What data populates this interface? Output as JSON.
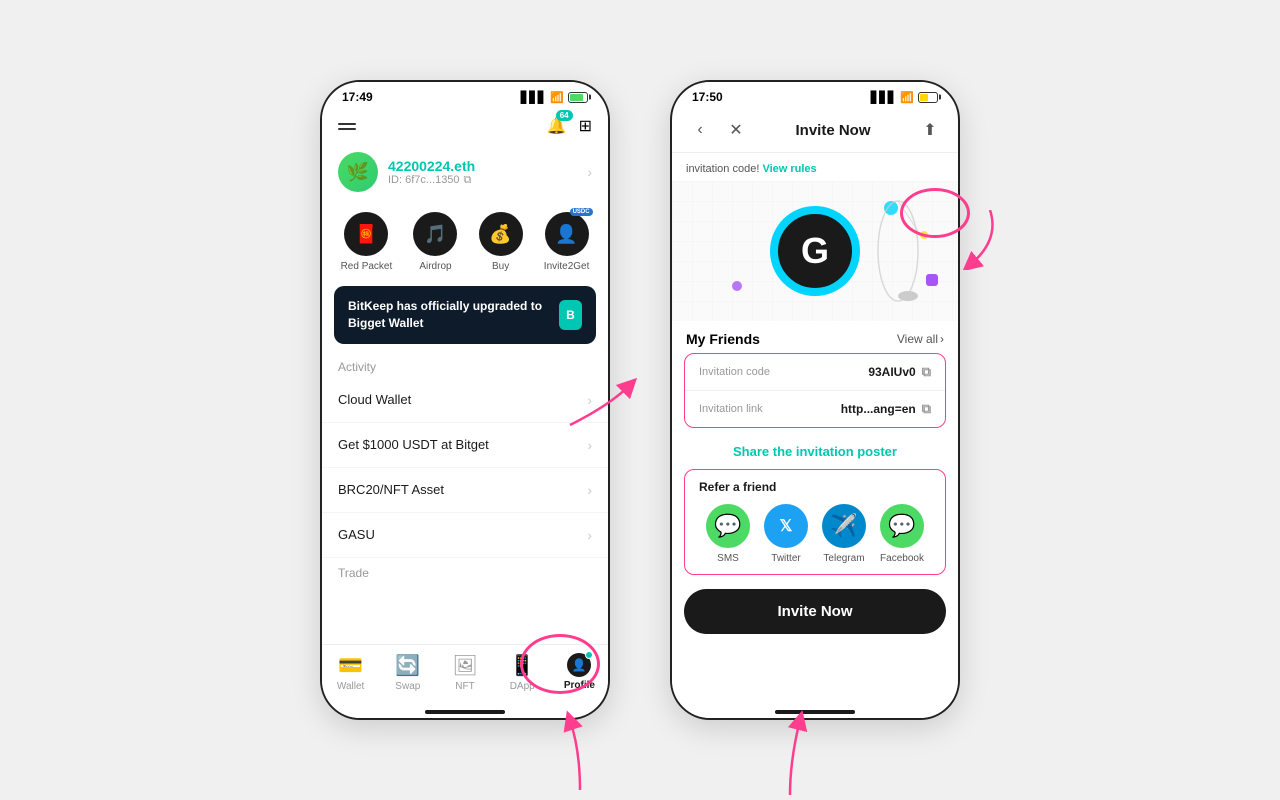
{
  "phone1": {
    "time": "17:49",
    "battery_fill": "green",
    "profile_name": "42200224.eth",
    "profile_id": "ID: 6f7c...1350",
    "actions": [
      {
        "label": "Red Packet",
        "icon": "🧧"
      },
      {
        "label": "Airdrop",
        "icon": "🎵"
      },
      {
        "label": "Buy",
        "icon": "💰"
      },
      {
        "label": "Invite2Get",
        "icon": "👤"
      }
    ],
    "banner_text": "BitKeep has officially upgraded to Bigget Wallet",
    "activity_label": "Activity",
    "activity_items": [
      {
        "text": "Cloud Wallet"
      },
      {
        "text": "Get $1000 USDT at Bitget"
      },
      {
        "text": "BRC20/NFT Asset"
      },
      {
        "text": "GASU"
      }
    ],
    "trade_label": "Trade",
    "bottom_nav": [
      {
        "label": "Wallet",
        "icon": "💳"
      },
      {
        "label": "Swap",
        "icon": "🔄"
      },
      {
        "label": "NFT",
        "icon": "🖼"
      },
      {
        "label": "DApp",
        "icon": "📱"
      },
      {
        "label": "Profile",
        "icon": "👤",
        "active": true
      }
    ],
    "bell_badge": "64"
  },
  "phone2": {
    "time": "17:50",
    "battery_fill": "yellow",
    "nav_title": "Invite Now",
    "promo_text": "invitation code!",
    "view_rules": "View rules",
    "friends_title": "My Friends",
    "view_all": "View all",
    "invitation_code_label": "Invitation code",
    "invitation_code_value": "93AIUv0",
    "invitation_link_label": "Invitation link",
    "invitation_link_value": "http...ang=en",
    "share_poster": "Share the invitation poster",
    "refer_title": "Refer a friend",
    "refer_items": [
      {
        "label": "SMS",
        "bg": "sms"
      },
      {
        "label": "Twitter",
        "bg": "twitter"
      },
      {
        "label": "Telegram",
        "bg": "telegram"
      },
      {
        "label": "Facebook",
        "bg": "facebook"
      }
    ],
    "invite_btn": "Invite Now"
  }
}
